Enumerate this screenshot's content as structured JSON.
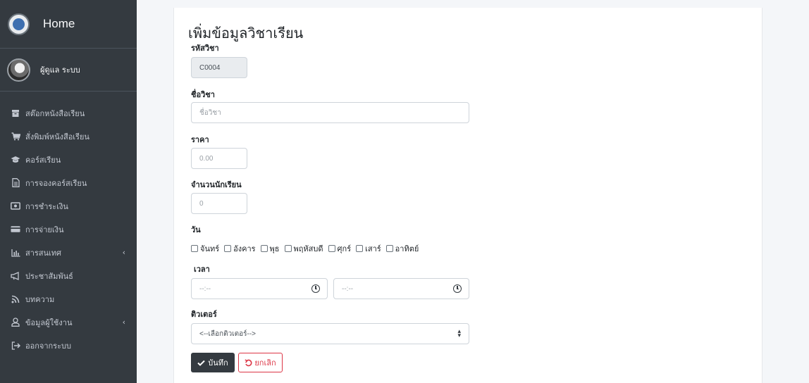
{
  "sidebar": {
    "brand": "Home",
    "user_name": "ผู้ดูแล ระบบ",
    "items": [
      {
        "label": "สต๊อกหนังสือเรียน",
        "icon": "archive-icon"
      },
      {
        "label": "สั่งพิมพ์หนังสือเรียน",
        "icon": "cart-icon"
      },
      {
        "label": "คอร์สเรียน",
        "icon": "graduation-cap-icon"
      },
      {
        "label": "การจองคอร์สเรียน",
        "icon": "file-text-icon"
      },
      {
        "label": "การชำระเงิน",
        "icon": "money-bill-icon"
      },
      {
        "label": "การจ่ายเงิน",
        "icon": "credit-card-icon"
      },
      {
        "label": "สารสนเทศ",
        "icon": "bar-chart-icon",
        "caret": "‹"
      },
      {
        "label": "ประชาสัมพันธ์",
        "icon": "bullhorn-icon"
      },
      {
        "label": "บทความ",
        "icon": "rss-icon"
      },
      {
        "label": "ข้อมูลผู้ใช้งาน",
        "icon": "user-icon",
        "caret": "‹"
      },
      {
        "label": "ออกจากระบบ",
        "icon": "sign-out-icon"
      }
    ]
  },
  "form": {
    "title": "เพิ่มข้อมูลวิชาเรียน",
    "course_code_label": "รหัสวิชา",
    "course_code_value": "C0004",
    "course_name_label": "ชื่อวิชา",
    "course_name_placeholder": "ชื่อวิชา",
    "price_label": "ราคา",
    "price_placeholder": "0.00",
    "students_label": "จำนวนนักเรียน",
    "students_placeholder": "0",
    "days_label": "วัน",
    "days": [
      "จันทร์",
      "อังคาร",
      "พุธ",
      "พฤหัสบดี",
      "ศุกร์",
      "เสาร์",
      "อาทิตย์"
    ],
    "time_label": "เวลา",
    "time_start_placeholder": "--:--",
    "time_end_placeholder": "--:--",
    "tutor_label": "ติวเตอร์",
    "tutor_selected": "<--เลือกติวเตอร์-->",
    "save_label": "บันทึก",
    "cancel_label": "ยกเลิก"
  }
}
